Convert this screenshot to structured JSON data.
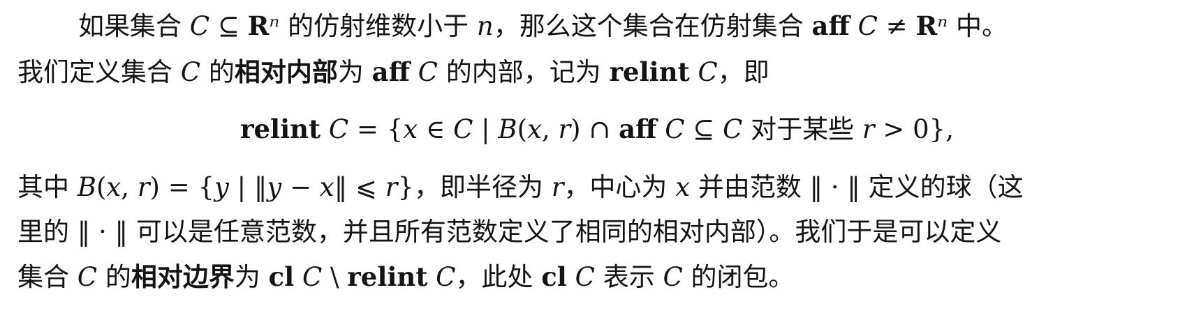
{
  "paragraph1": {
    "line1": [
      {
        "t": "如果集合 ",
        "s": "cjk"
      },
      {
        "t": "C",
        "s": "i"
      },
      {
        "t": " ⊆ ",
        "s": "math"
      },
      {
        "t": "R",
        "s": "bold"
      },
      {
        "t": "ⁿ",
        "s": "i"
      },
      {
        "t": " 的仿射维数小于 ",
        "s": "cjk"
      },
      {
        "t": "n",
        "s": "i"
      },
      {
        "t": "，那么这个集合在仿射集合 ",
        "s": "cjk"
      },
      {
        "t": "aff",
        "s": "bold"
      },
      {
        "t": " C",
        "s": "i"
      },
      {
        "t": " ≠ ",
        "s": "math"
      },
      {
        "t": "R",
        "s": "bold"
      },
      {
        "t": "ⁿ",
        "s": "i"
      },
      {
        "t": " 中。",
        "s": "cjk"
      }
    ],
    "line2": [
      {
        "t": "我们定义集合 ",
        "s": "cjk"
      },
      {
        "t": "C",
        "s": "i"
      },
      {
        "t": " 的",
        "s": "cjk"
      },
      {
        "t": "相对内部",
        "s": "cjk bold"
      },
      {
        "t": "为 ",
        "s": "cjk"
      },
      {
        "t": "aff",
        "s": "bold"
      },
      {
        "t": " C",
        "s": "i"
      },
      {
        "t": " 的内部，记为 ",
        "s": "cjk"
      },
      {
        "t": "relint",
        "s": "bold"
      },
      {
        "t": " C",
        "s": "i"
      },
      {
        "t": "，即",
        "s": "cjk"
      }
    ]
  },
  "display_equation": [
    {
      "t": "relint",
      "s": "bold"
    },
    {
      "t": " C",
      "s": "i"
    },
    {
      "t": " = {",
      "s": "math"
    },
    {
      "t": "x",
      "s": "i"
    },
    {
      "t": " ∈ ",
      "s": "math"
    },
    {
      "t": "C",
      "s": "i"
    },
    {
      "t": " | ",
      "s": "math"
    },
    {
      "t": "B",
      "s": "i"
    },
    {
      "t": "(",
      "s": "math"
    },
    {
      "t": "x",
      "s": "i"
    },
    {
      "t": ", ",
      "s": "math"
    },
    {
      "t": "r",
      "s": "i"
    },
    {
      "t": ") ∩ ",
      "s": "math"
    },
    {
      "t": "aff",
      "s": "bold"
    },
    {
      "t": " C",
      "s": "i"
    },
    {
      "t": " ⊆ ",
      "s": "math"
    },
    {
      "t": "C",
      "s": "i"
    },
    {
      "t": " 对于某些 ",
      "s": "cjk"
    },
    {
      "t": "r",
      "s": "i"
    },
    {
      "t": " > 0},",
      "s": "math"
    }
  ],
  "paragraph2": {
    "line1": [
      {
        "t": "其中 ",
        "s": "cjk"
      },
      {
        "t": "B",
        "s": "i"
      },
      {
        "t": "(",
        "s": "math"
      },
      {
        "t": "x",
        "s": "i"
      },
      {
        "t": ", ",
        "s": "math"
      },
      {
        "t": "r",
        "s": "i"
      },
      {
        "t": ") = {",
        "s": "math"
      },
      {
        "t": "y",
        "s": "i"
      },
      {
        "t": " | ‖",
        "s": "math"
      },
      {
        "t": "y",
        "s": "i"
      },
      {
        "t": " − ",
        "s": "math"
      },
      {
        "t": "x",
        "s": "i"
      },
      {
        "t": "‖ ⩽ ",
        "s": "math"
      },
      {
        "t": "r",
        "s": "i"
      },
      {
        "t": "}",
        "s": "math"
      },
      {
        "t": "，即半径为 ",
        "s": "cjk"
      },
      {
        "t": "r",
        "s": "i"
      },
      {
        "t": "，中心为 ",
        "s": "cjk"
      },
      {
        "t": "x",
        "s": "i"
      },
      {
        "t": " 并由范数 ",
        "s": "cjk"
      },
      {
        "t": "‖ · ‖",
        "s": "math"
      },
      {
        "t": " 定义的球（这",
        "s": "cjk"
      }
    ],
    "line2": [
      {
        "t": "里的 ",
        "s": "cjk"
      },
      {
        "t": "‖ · ‖",
        "s": "math"
      },
      {
        "t": " 可以是任意范数，并且所有范数定义了相同的相对内部）。我们于是可以定义",
        "s": "cjk"
      }
    ],
    "line3": [
      {
        "t": "集合 ",
        "s": "cjk"
      },
      {
        "t": "C",
        "s": "i"
      },
      {
        "t": " 的",
        "s": "cjk"
      },
      {
        "t": "相对边界",
        "s": "cjk bold"
      },
      {
        "t": "为 ",
        "s": "cjk"
      },
      {
        "t": "cl",
        "s": "bold"
      },
      {
        "t": " C",
        "s": "i"
      },
      {
        "t": " \\ ",
        "s": "math"
      },
      {
        "t": "relint",
        "s": "bold"
      },
      {
        "t": " C",
        "s": "i"
      },
      {
        "t": "，此处 ",
        "s": "cjk"
      },
      {
        "t": "cl",
        "s": "bold"
      },
      {
        "t": " C",
        "s": "i"
      },
      {
        "t": " 表示 ",
        "s": "cjk"
      },
      {
        "t": "C",
        "s": "i"
      },
      {
        "t": " 的闭包。",
        "s": "cjk"
      }
    ]
  }
}
